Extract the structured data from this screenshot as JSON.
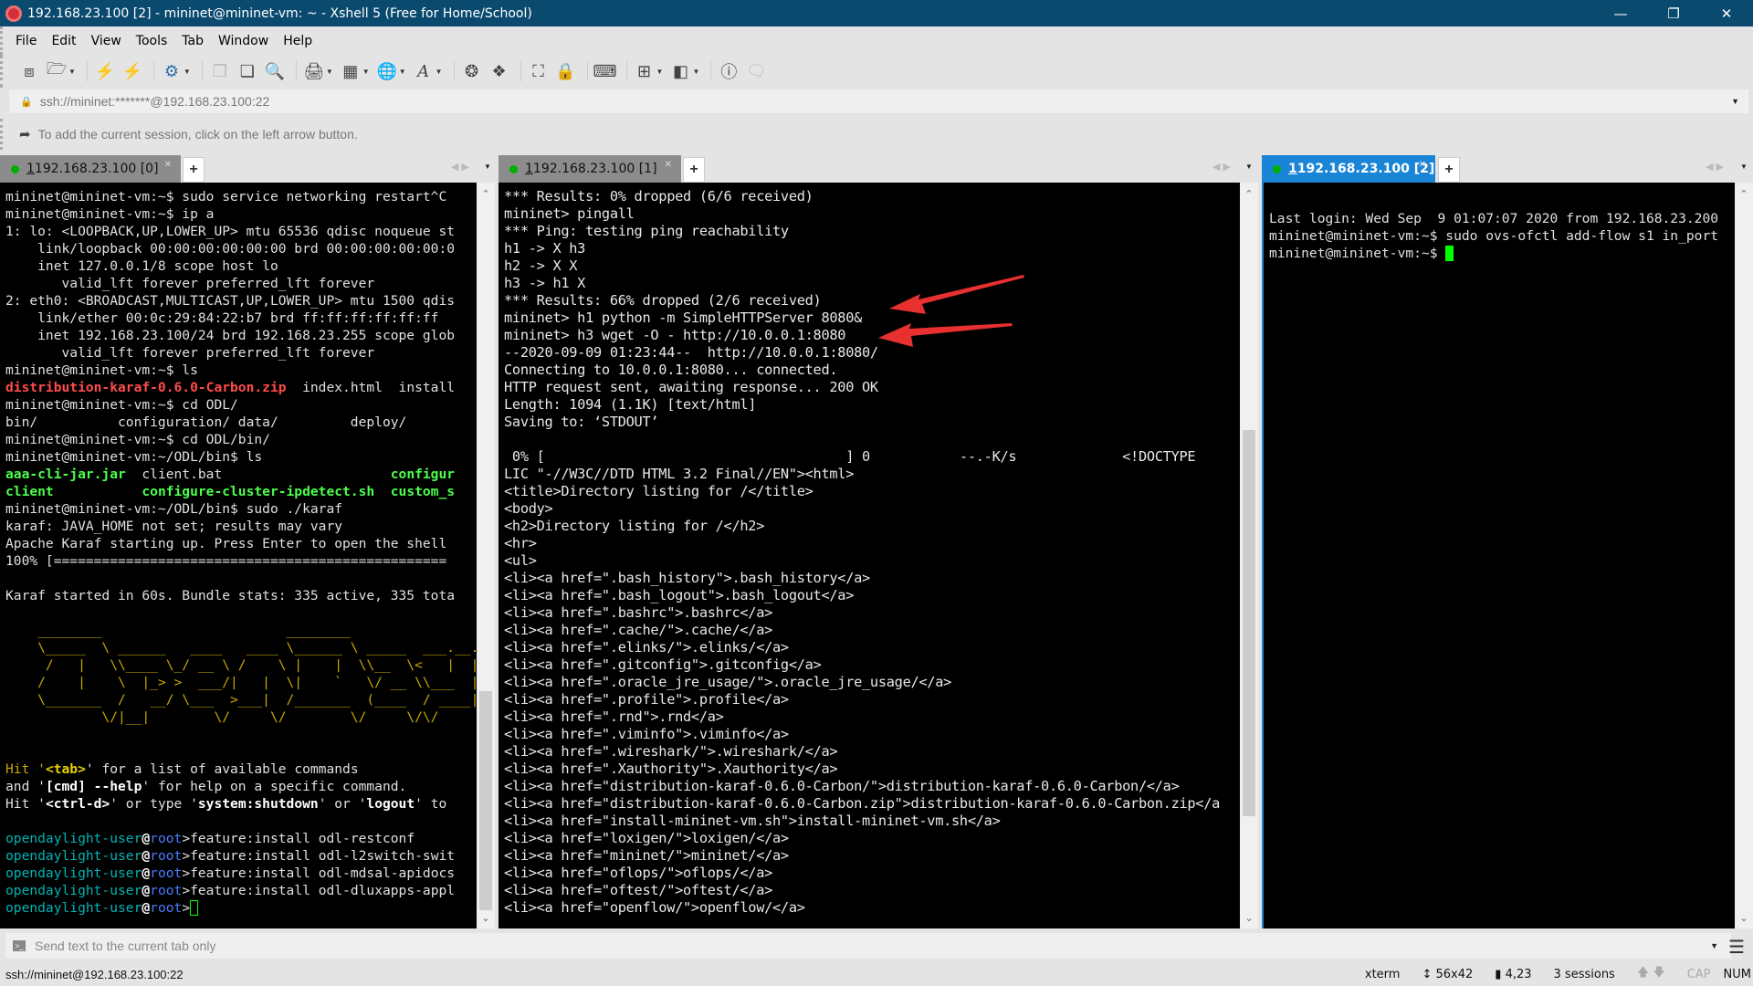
{
  "window": {
    "title": "192.168.23.100 [2] - mininet@mininet-vm: ~ - Xshell 5 (Free for Home/School)"
  },
  "menu": [
    "File",
    "Edit",
    "View",
    "Tools",
    "Tab",
    "Window",
    "Help"
  ],
  "address": {
    "value": "ssh://mininet:*******@192.168.23.100:22"
  },
  "links_hint": "To add the current session, click on the left arrow button.",
  "colors": {
    "titlebar": "#0b4a6f",
    "active_tab": "#1a85d6",
    "arrow": "#e83030",
    "cursor": "#00ff00"
  },
  "panes": [
    {
      "tab": {
        "num": "1",
        "label": " 192.168.23.100 [0]",
        "active": false
      },
      "cursor": "outline",
      "scroll_position_pct": 100,
      "lines": [
        "mininet@mininet-vm:~$ sudo service networking restart^C",
        "mininet@mininet-vm:~$ ip a",
        "1: lo: <LOOPBACK,UP,LOWER_UP> mtu 65536 qdisc noqueue st",
        "    link/loopback 00:00:00:00:00:00 brd 00:00:00:00:00:0",
        "    inet 127.0.0.1/8 scope host lo",
        "       valid_lft forever preferred_lft forever",
        "2: eth0: <BROADCAST,MULTICAST,UP,LOWER_UP> mtu 1500 qdis",
        "    link/ether 00:0c:29:84:22:b7 brd ff:ff:ff:ff:ff:ff",
        "    inet 192.168.23.100/24 brd 192.168.23.255 scope glob",
        "       valid_lft forever preferred_lft forever",
        "mininet@mininet-vm:~$ ls",
        [
          {
            "t": "distribution-karaf-0.6.0-Carbon.zip",
            "s": "red"
          },
          {
            "t": "  index.html  install"
          }
        ],
        "mininet@mininet-vm:~$ cd ODL/",
        "bin/          configuration/ data/         deploy/",
        "mininet@mininet-vm:~$ cd ODL/bin/",
        "mininet@mininet-vm:~/ODL/bin$ ls",
        [
          {
            "t": "aaa-cli-jar.jar",
            "s": "green"
          },
          {
            "t": "  client.bat                     "
          },
          {
            "t": "configur",
            "s": "green"
          }
        ],
        [
          {
            "t": "client",
            "s": "green"
          },
          {
            "t": "           "
          },
          {
            "t": "configure-cluster-ipdetect.sh",
            "s": "green"
          },
          {
            "t": "  "
          },
          {
            "t": "custom_s",
            "s": "green"
          }
        ],
        "mininet@mininet-vm:~/ODL/bin$ sudo ./karaf",
        "karaf: JAVA_HOME not set; results may vary",
        "Apache Karaf starting up. Press Enter to open the shell",
        "100% [=================================================",
        "",
        "Karaf started in 60s. Bundle stats: 335 active, 335 tota",
        "",
        [
          {
            "t": "    ________                       ________                .__  .__",
            "s": "yel"
          }
        ],
        [
          {
            "t": "    \\_____  \\ ______   ____   ____ \\______ \\ _____  ___.__.|  | |__|",
            "s": "yel"
          }
        ],
        [
          {
            "t": "     /   |   \\\\____ \\_/ __ \\ /    \\ |    |  \\\\__  \\<   |  ||  | |  |",
            "s": "yel"
          }
        ],
        [
          {
            "t": "    /    |    \\  |_> >  ___/|   |  \\|    `   \\/ __ \\\\___  ||  |_|  |",
            "s": "yel"
          }
        ],
        [
          {
            "t": "    \\_______  /   __/ \\___  >___|  /_______  (____  / ____||____/__|",
            "s": "yel"
          }
        ],
        [
          {
            "t": "            \\/|__|        \\/     \\/        \\/     \\/\\/",
            "s": "yel"
          }
        ],
        "",
        "",
        [
          {
            "t": "Hit '",
            "s": "yel"
          },
          {
            "t": "<tab>",
            "s": "yelb"
          },
          {
            "t": "' for a list of available commands"
          }
        ],
        [
          {
            "t": "and '"
          },
          {
            "t": "[cmd] --help",
            "s": "bold"
          },
          {
            "t": "' for help on a specific command."
          }
        ],
        [
          {
            "t": "Hit '"
          },
          {
            "t": "<ctrl-d>",
            "s": "bold"
          },
          {
            "t": "' or type '"
          },
          {
            "t": "system:shutdown",
            "s": "bold"
          },
          {
            "t": "' or '"
          },
          {
            "t": "logout",
            "s": "bold"
          },
          {
            "t": "' to"
          }
        ],
        "",
        [
          {
            "t": "opendaylight-user",
            "s": "teal"
          },
          {
            "t": "@",
            "s": "bold"
          },
          {
            "t": "root",
            "s": "blue"
          },
          {
            "t": ">feature:install odl-restconf"
          }
        ],
        [
          {
            "t": "opendaylight-user",
            "s": "teal"
          },
          {
            "t": "@",
            "s": "bold"
          },
          {
            "t": "root",
            "s": "blue"
          },
          {
            "t": ">feature:install odl-l2switch-swit"
          }
        ],
        [
          {
            "t": "opendaylight-user",
            "s": "teal"
          },
          {
            "t": "@",
            "s": "bold"
          },
          {
            "t": "root",
            "s": "blue"
          },
          {
            "t": ">feature:install odl-mdsal-apidocs"
          }
        ],
        [
          {
            "t": "opendaylight-user",
            "s": "teal"
          },
          {
            "t": "@",
            "s": "bold"
          },
          {
            "t": "root",
            "s": "blue"
          },
          {
            "t": ">feature:install odl-dluxapps-appl"
          }
        ],
        [
          {
            "t": "opendaylight-user",
            "s": "teal"
          },
          {
            "t": "@",
            "s": "bold"
          },
          {
            "t": "root",
            "s": "blue"
          },
          {
            "t": ">"
          }
        ]
      ]
    },
    {
      "tab": {
        "num": "1",
        "label": " 192.168.23.100 [1]",
        "active": false
      },
      "cursor": "none",
      "scroll_position_pct": 60,
      "lines": [
        "*** Results: 0% dropped (6/6 received)",
        "mininet> pingall",
        "*** Ping: testing ping reachability",
        "h1 -> X h3",
        "h2 -> X X",
        "h3 -> h1 X",
        "*** Results: 66% dropped (2/6 received)",
        "mininet> h1 python -m SimpleHTTPServer 8080&",
        "mininet> h3 wget -O - http://10.0.0.1:8080",
        "--2020-09-09 01:23:44--  http://10.0.0.1:8080/",
        "Connecting to 10.0.0.1:8080... connected.",
        "HTTP request sent, awaiting response... 200 OK",
        "Length: 1094 (1.1K) [text/html]",
        "Saving to: ‘STDOUT’",
        "",
        " 0% [                                     ] 0           --.-K/s             <!DOCTYPE",
        "LIC \"-//W3C//DTD HTML 3.2 Final//EN\"><html>",
        "<title>Directory listing for /</title>",
        "<body>",
        "<h2>Directory listing for /</h2>",
        "<hr>",
        "<ul>",
        "<li><a href=\".bash_history\">.bash_history</a>",
        "<li><a href=\".bash_logout\">.bash_logout</a>",
        "<li><a href=\".bashrc\">.bashrc</a>",
        "<li><a href=\".cache/\">.cache/</a>",
        "<li><a href=\".elinks/\">.elinks/</a>",
        "<li><a href=\".gitconfig\">.gitconfig</a>",
        "<li><a href=\".oracle_jre_usage/\">.oracle_jre_usage/</a>",
        "<li><a href=\".profile\">.profile</a>",
        "<li><a href=\".rnd\">.rnd</a>",
        "<li><a href=\".viminfo\">.viminfo</a>",
        "<li><a href=\".wireshark/\">.wireshark/</a>",
        "<li><a href=\".Xauthority\">.Xauthority</a>",
        "<li><a href=\"distribution-karaf-0.6.0-Carbon/\">distribution-karaf-0.6.0-Carbon/</a>",
        "<li><a href=\"distribution-karaf-0.6.0-Carbon.zip\">distribution-karaf-0.6.0-Carbon.zip</a",
        "<li><a href=\"install-mininet-vm.sh\">install-mininet-vm.sh</a>",
        "<li><a href=\"loxigen/\">loxigen/</a>",
        "<li><a href=\"mininet/\">mininet/</a>",
        "<li><a href=\"oflops/\">oflops/</a>",
        "<li><a href=\"oftest/\">oftest/</a>",
        "<li><a href=\"openflow/\">openflow/</a>"
      ]
    },
    {
      "tab": {
        "num": "1",
        "label": " 192.168.23.100 [2]",
        "active": true
      },
      "cursor": "filled",
      "scroll_position_pct": 0,
      "lines": [
        "",
        "Last login: Wed Sep  9 01:07:07 2020 from 192.168.23.200",
        "mininet@mininet-vm:~$ sudo ovs-ofctl add-flow s1 in_port",
        "mininet@mininet-vm:~$ "
      ]
    }
  ],
  "send_bar": {
    "placeholder": "Send text to the current tab only"
  },
  "status": {
    "connection": "ssh://mininet@192.168.23.100:22",
    "terminal_type": "xterm",
    "size": "56x42",
    "cursor_pos": "4,23",
    "sessions": "3 sessions",
    "cap": "CAP",
    "num": "NUM"
  }
}
